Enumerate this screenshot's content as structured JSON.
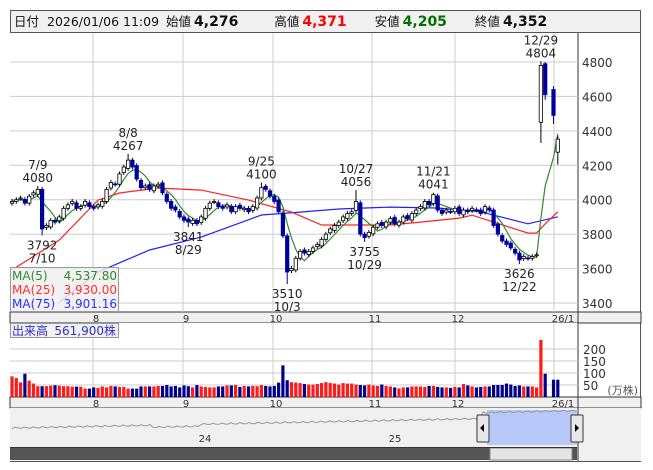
{
  "header": {
    "date_label": "日付",
    "date_value": "2026/01/06 11:09",
    "open_label": "始値",
    "open_value": "4,276",
    "high_label": "高値",
    "high_value": "4,371",
    "low_label": "安値",
    "low_value": "4,205",
    "close_label": "終値",
    "close_value": "4,352"
  },
  "legend": {
    "ma5_label": "MA(5)",
    "ma5_value": "4,537.80",
    "ma25_label": "MA(25)",
    "ma25_value": "3,930.00",
    "ma75_label": "MA(75)",
    "ma75_value": "3,901.16"
  },
  "volume_legend": {
    "label": "出来高",
    "value": "561,900株"
  },
  "colors": {
    "up_volume": "#ff1a1a",
    "down_volume": "#00008b",
    "candle_down": "#00009c",
    "ma5": "#2e8b2e",
    "ma25": "#ff2020",
    "ma75": "#2020ff",
    "header_high": "#ff0000",
    "header_low": "#007000"
  },
  "chart_data": {
    "type": "candlestick",
    "price_axis": {
      "min": 3400,
      "max": 4800,
      "ticks": [
        "3400",
        "3600",
        "3800",
        "4000",
        "4200",
        "4400",
        "4600",
        "4800"
      ]
    },
    "month_labels": [
      {
        "label": "8",
        "index": 22
      },
      {
        "label": "9",
        "index": 42
      },
      {
        "label": "10",
        "index": 62
      },
      {
        "label": "11",
        "index": 84
      },
      {
        "label": "12",
        "index": 103
      },
      {
        "label": "26/1",
        "index": 125
      }
    ],
    "closes": [
      3990,
      4000,
      4010,
      3980,
      4020,
      4040,
      4060,
      3830,
      3850,
      3880,
      3870,
      3900,
      3950,
      3970,
      3990,
      3950,
      3960,
      3990,
      3960,
      3950,
      3970,
      3990,
      4060,
      4100,
      4090,
      4150,
      4190,
      4230,
      4190,
      4120,
      4070,
      4080,
      4060,
      4080,
      4090,
      4040,
      3990,
      3950,
      3940,
      3900,
      3880,
      3870,
      3880,
      3860,
      3900,
      3950,
      3980,
      3990,
      3960,
      3950,
      3970,
      3930,
      3960,
      3950,
      3950,
      3930,
      3960,
      4010,
      4070,
      4060,
      4020,
      3990,
      3930,
      3790,
      3580,
      3600,
      3660,
      3700,
      3690,
      3700,
      3720,
      3740,
      3770,
      3800,
      3830,
      3850,
      3870,
      3900,
      3920,
      3930,
      3990,
      3800,
      3780,
      3810,
      3840,
      3860,
      3850,
      3870,
      3890,
      3860,
      3870,
      3900,
      3890,
      3920,
      3940,
      3960,
      3990,
      3970,
      4030,
      3940,
      3920,
      3940,
      3930,
      3950,
      3920,
      3940,
      3930,
      3950,
      3940,
      3920,
      3960,
      3940,
      3850,
      3800,
      3760,
      3740,
      3720,
      3690,
      3650,
      3670,
      3660,
      3670,
      3680
    ],
    "last_candles": [
      {
        "o": 4450,
        "h": 4804,
        "l": 4330,
        "c": 4780
      },
      {
        "o": 4790,
        "h": 4800,
        "l": 4580,
        "c": 4610
      },
      {
        "o": 4640,
        "h": 4660,
        "l": 4440,
        "c": 4490
      },
      {
        "o": 4276,
        "h": 4371,
        "l": 4205,
        "c": 4352
      }
    ],
    "volumes": [
      86,
      79,
      61,
      97,
      68,
      56,
      45,
      45,
      45,
      47,
      49,
      47,
      45,
      45,
      43,
      43,
      43,
      35,
      35,
      40,
      38,
      44,
      40,
      46,
      44,
      42,
      42,
      35,
      35,
      35,
      44,
      44,
      44,
      44,
      46,
      46,
      50,
      44,
      46,
      40,
      48,
      45,
      40,
      50,
      44,
      42,
      40,
      40,
      44,
      44,
      48,
      48,
      50,
      42,
      46,
      44,
      46,
      45,
      50,
      46,
      44,
      46,
      60,
      132,
      70,
      62,
      60,
      58,
      54,
      52,
      52,
      54,
      58,
      62,
      58,
      56,
      52,
      58,
      56,
      56,
      52,
      50,
      48,
      52,
      48,
      46,
      52,
      46,
      44,
      40,
      36,
      40,
      40,
      44,
      44,
      44,
      42,
      46,
      46,
      42,
      40,
      40,
      38,
      42,
      40,
      54,
      48,
      44,
      40,
      42,
      44,
      44,
      50,
      50,
      50,
      56,
      52,
      46,
      48,
      44,
      44,
      44,
      40,
      238,
      97,
      72,
      72
    ],
    "volume_axis": {
      "max": 250,
      "ticks": [
        "50",
        "100",
        "150",
        "200"
      ],
      "unit": "(万株)"
    },
    "ma25": [
      [
        0,
        3592
      ],
      [
        11,
        3766
      ],
      [
        20,
        3998
      ],
      [
        25,
        4039
      ],
      [
        34,
        4068
      ],
      [
        44,
        4056
      ],
      [
        55,
        3998
      ],
      [
        65,
        3928
      ],
      [
        72,
        3853
      ],
      [
        88,
        3853
      ],
      [
        95,
        3870
      ],
      [
        104,
        3893
      ],
      [
        107,
        3910
      ],
      [
        120,
        3806
      ],
      [
        122,
        3806
      ],
      [
        124,
        3860
      ],
      [
        126,
        3930
      ]
    ],
    "ma75": [
      [
        11,
        3405
      ],
      [
        20,
        3580
      ],
      [
        32,
        3708
      ],
      [
        44,
        3783
      ],
      [
        58,
        3911
      ],
      [
        67,
        3928
      ],
      [
        76,
        3946
      ],
      [
        88,
        3957
      ],
      [
        99,
        3952
      ],
      [
        109,
        3930
      ],
      [
        120,
        3860
      ],
      [
        126,
        3901
      ]
    ],
    "annotations": [
      {
        "date": "7/9",
        "value": "4080",
        "index": 6,
        "pos": "above"
      },
      {
        "date": "7/10",
        "value": "3792",
        "index": 7,
        "pos": "below"
      },
      {
        "date": "8/8",
        "value": "4267",
        "index": 27,
        "pos": "above"
      },
      {
        "date": "8/29",
        "value": "3841",
        "index": 41,
        "pos": "below"
      },
      {
        "date": "9/25",
        "value": "4100",
        "index": 58,
        "pos": "above"
      },
      {
        "date": "10/3",
        "value": "3510",
        "index": 64,
        "pos": "below"
      },
      {
        "date": "10/27",
        "value": "4056",
        "index": 80,
        "pos": "above"
      },
      {
        "date": "10/29",
        "value": "3755",
        "index": 82,
        "pos": "below"
      },
      {
        "date": "11/21",
        "value": "4041",
        "index": 98,
        "pos": "above"
      },
      {
        "date": "12/22",
        "value": "3626",
        "index": 118,
        "pos": "below"
      },
      {
        "date": "12/29",
        "value": "4804",
        "index": 123,
        "pos": "above"
      }
    ],
    "navigator_labels": [
      {
        "label": "24"
      },
      {
        "label": "25"
      }
    ]
  }
}
